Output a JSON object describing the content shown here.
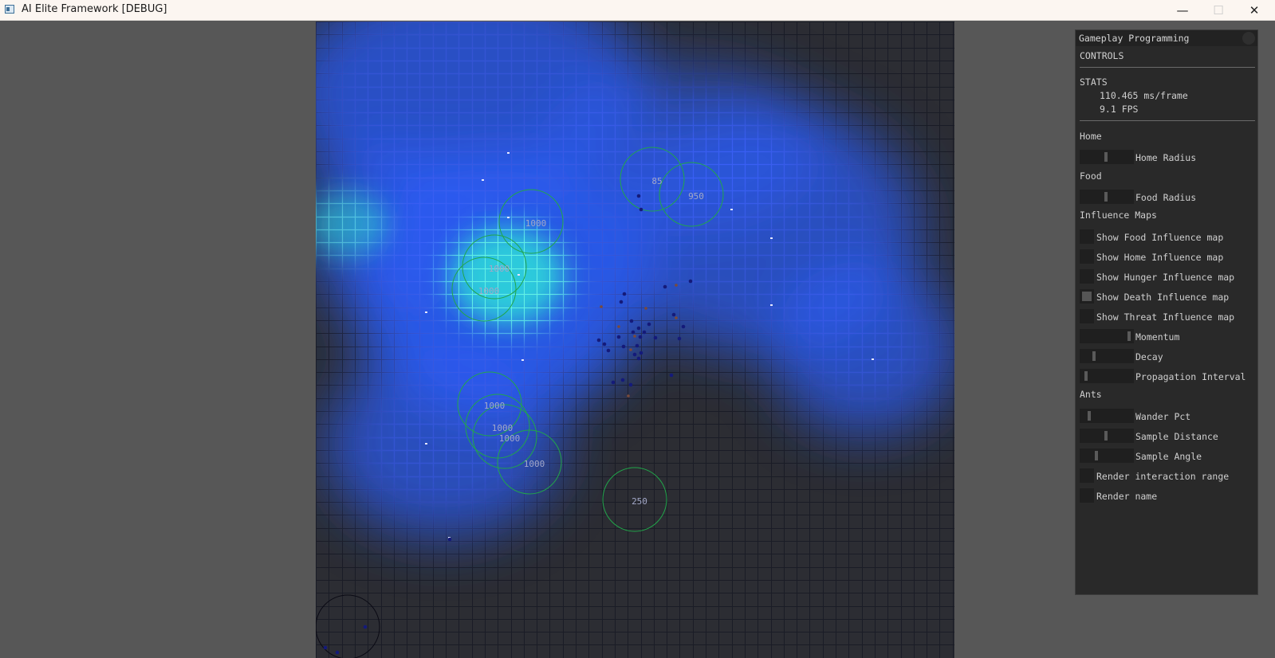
{
  "window": {
    "title": "AI Elite Framework [DEBUG]",
    "minimize_glyph": "—",
    "maximize_glyph": "☐",
    "close_glyph": "✕"
  },
  "world": {
    "colors": {
      "background": "#2c2d33",
      "grid_line_dark": "#1a1c26",
      "influence_blue": "#2a5cf5",
      "influence_cyan": "#2ff0d8",
      "circle_green": "#21a64a",
      "ant_dark": "#141a7a",
      "ant_light": "#e6e8ff",
      "food_label": "#a3a8c8"
    },
    "food_labels": [
      "85",
      "950",
      "1000",
      "1000",
      "1000",
      "1000",
      "1000",
      "1000",
      "1000",
      "250"
    ]
  },
  "panel": {
    "header": "Gameplay Programming",
    "controls_header": "CONTROLS",
    "stats_header": "STATS",
    "ms_per_frame": "110.465 ms/frame",
    "fps": "9.1 FPS",
    "home_section": "Home",
    "home_radius_label": "Home Radius",
    "home_radius_level": 0.47,
    "food_section": "Food",
    "food_radius_label": "Food Radius",
    "food_radius_level": 0.47,
    "influence_section": "Influence Maps",
    "show_food_label": "Show Food Influence map",
    "show_food_checked": false,
    "show_home_label": "Show Home Influence map",
    "show_home_checked": false,
    "show_hunger_label": "Show Hunger Influence map",
    "show_hunger_checked": false,
    "show_death_label": "Show Death Influence map",
    "show_death_checked": true,
    "show_threat_label": "Show Threat Influence map",
    "show_threat_checked": false,
    "momentum_label": "Momentum",
    "momentum_level": 0.93,
    "decay_label": "Decay",
    "decay_level": 0.22,
    "propagation_label": "Propagation Interval",
    "propagation_level": 0.06,
    "ants_section": "Ants",
    "wander_label": "Wander Pct",
    "wander_level": 0.13,
    "sample_distance_label": "Sample Distance",
    "sample_distance_level": 0.47,
    "sample_angle_label": "Sample Angle",
    "sample_angle_level": 0.27,
    "render_range_label": "Render interaction range",
    "render_range_checked": false,
    "render_name_label": "Render name",
    "render_name_checked": false
  }
}
